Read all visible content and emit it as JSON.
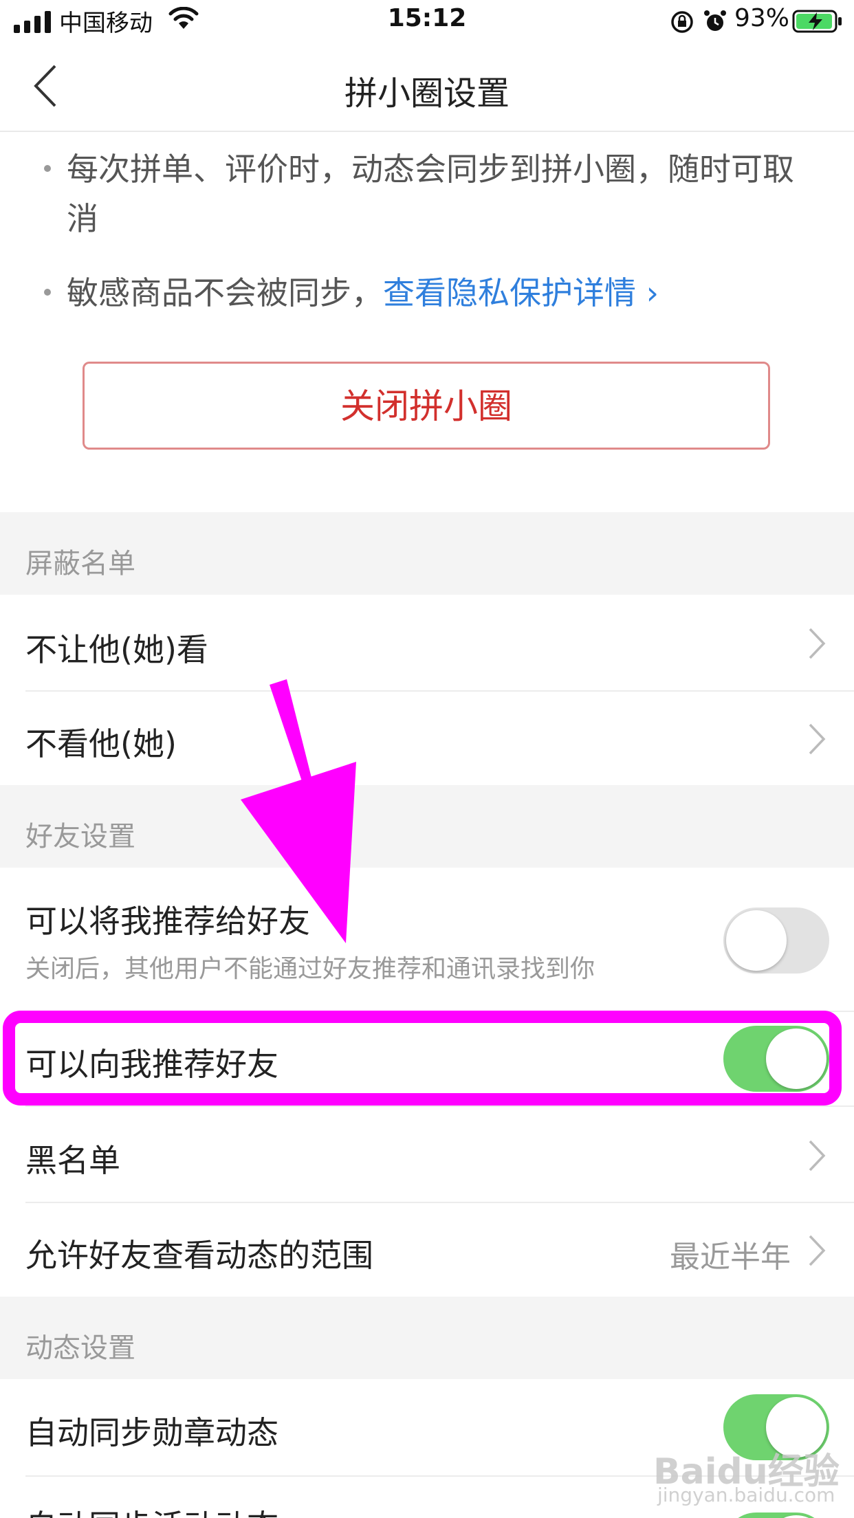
{
  "status_bar": {
    "carrier": "中国移动",
    "time": "15:12",
    "battery_percent": "93%"
  },
  "nav": {
    "title": "拼小圈设置"
  },
  "intro": {
    "bullet1": "每次拼单、评价时，动态会同步到拼小圈，随时可取消",
    "bullet2_prefix": "敏感商品不会被同步，",
    "bullet2_link": "查看隐私保护详情 ›"
  },
  "close_button_label": "关闭拼小圈",
  "block_section": {
    "title": "屏蔽名单",
    "items": [
      {
        "label": "不让他(她)看"
      },
      {
        "label": "不看他(她)"
      }
    ]
  },
  "friend_section": {
    "title": "好友设置",
    "recommend_me": {
      "label": "可以将我推荐给好友",
      "sub": "关闭后，其他用户不能通过好友推荐和通讯录找到你",
      "enabled": false
    },
    "recommend_to_me": {
      "label": "可以向我推荐好友",
      "enabled": true
    },
    "blacklist": {
      "label": "黑名单"
    },
    "visible_range": {
      "label": "允许好友查看动态的范围",
      "value": "最近半年"
    }
  },
  "feed_section": {
    "title": "动态设置",
    "auto_sync_badge": {
      "label": "自动同步勋章动态",
      "enabled": true
    },
    "auto_sync_activity": {
      "label": "自动同步活动动态",
      "enabled": true
    }
  },
  "watermark": {
    "brand": "Baidu经验",
    "url": "jingyan.baidu.com"
  },
  "colors": {
    "accent_link": "#2f7fdd",
    "danger": "#d2302d",
    "toggle_on": "#6fd36f",
    "annotation": "#ff00ff"
  }
}
